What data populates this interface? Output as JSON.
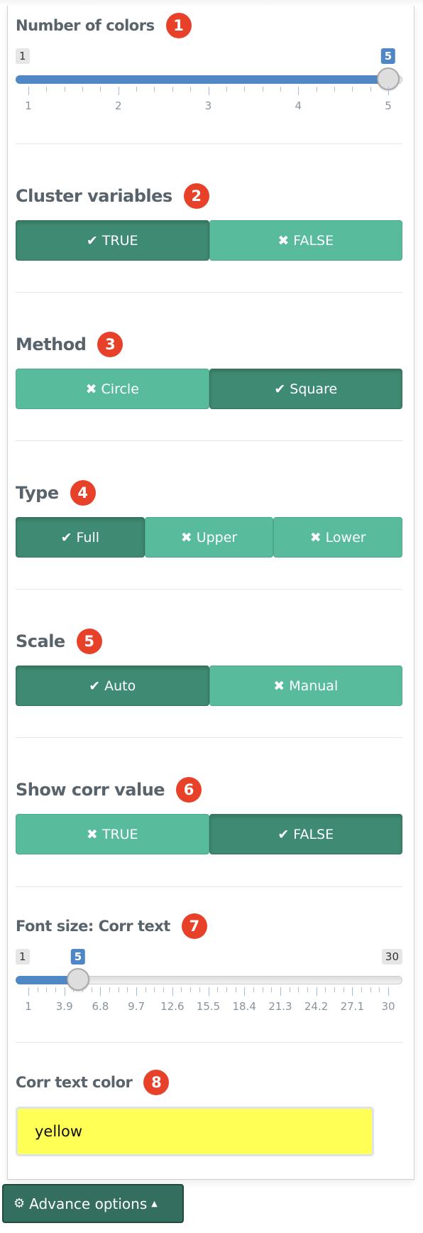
{
  "sections": {
    "num_colors": {
      "title": "Number of colors",
      "badge": "1",
      "min": 1,
      "max": 5,
      "value": 5,
      "min_label": "1",
      "value_label": "5",
      "ticks": [
        "1",
        "2",
        "3",
        "4",
        "5"
      ],
      "minor_per_major": 4
    },
    "cluster": {
      "title": "Cluster variables",
      "badge": "2",
      "options": [
        {
          "label": "TRUE",
          "icon": "check",
          "active": true
        },
        {
          "label": "FALSE",
          "icon": "times",
          "active": false
        }
      ]
    },
    "method": {
      "title": "Method",
      "badge": "3",
      "options": [
        {
          "label": "Circle",
          "icon": "times",
          "active": false
        },
        {
          "label": "Square",
          "icon": "check",
          "active": true
        }
      ]
    },
    "type": {
      "title": "Type",
      "badge": "4",
      "options": [
        {
          "label": "Full",
          "icon": "check",
          "active": true
        },
        {
          "label": "Upper",
          "icon": "times",
          "active": false
        },
        {
          "label": "Lower",
          "icon": "times",
          "active": false
        }
      ]
    },
    "scale": {
      "title": "Scale",
      "badge": "5",
      "options": [
        {
          "label": "Auto",
          "icon": "check",
          "active": true
        },
        {
          "label": "Manual",
          "icon": "times",
          "active": false
        }
      ]
    },
    "show_corr": {
      "title": "Show corr value",
      "badge": "6",
      "options": [
        {
          "label": "TRUE",
          "icon": "times",
          "active": false
        },
        {
          "label": "FALSE",
          "icon": "check",
          "active": true
        }
      ]
    },
    "font_size": {
      "title": "Font size: Corr text",
      "badge": "7",
      "min": 1,
      "max": 30,
      "value": 5,
      "min_label": "1",
      "max_label": "30",
      "value_label": "5",
      "ticks": [
        "1",
        "3.9",
        "6.8",
        "9.7",
        "12.6",
        "15.5",
        "18.4",
        "21.3",
        "24.2",
        "27.1",
        "30"
      ],
      "minor_per_major": 3
    },
    "corr_color": {
      "title": "Corr text color",
      "badge": "8",
      "value": "yellow"
    }
  },
  "advance_button": {
    "label": "Advance options",
    "icon": "gears-icon"
  },
  "colors": {
    "active": "#3f8a72",
    "inactive": "#57bb9c",
    "badge": "#e8412a",
    "slider": "#5088c5",
    "input_bg": "#ffff55"
  }
}
